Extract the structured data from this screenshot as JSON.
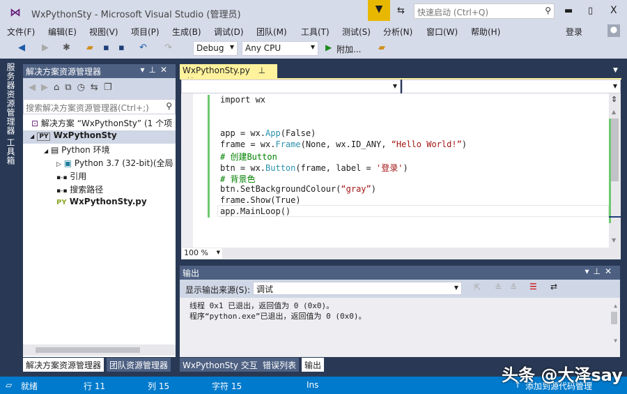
{
  "window": {
    "title": "WxPythonSty - Microsoft Visual Studio (管理员)",
    "quick_launch_placeholder": "快速启动 (Ctrl+Q)",
    "signin": "登录"
  },
  "menu": [
    "文件(F)",
    "编辑(E)",
    "视图(V)",
    "项目(P)",
    "生成(B)",
    "调试(D)",
    "团队(M)",
    "工具(T)",
    "测试(S)",
    "分析(N)",
    "窗口(W)",
    "帮助(H)"
  ],
  "toolbar": {
    "config": "Debug",
    "platform": "Any CPU",
    "attach": "附加..."
  },
  "side_tabs": [
    "服务器资源管理器",
    "工具箱"
  ],
  "solution_explorer": {
    "title": "解决方案资源管理器",
    "search_placeholder": "搜索解决方案资源管理器(Ctrl+;)",
    "tree": [
      {
        "label": "解决方案 “WxPythonSty” (1 个项",
        "icon": "solution-icon",
        "indent": 0
      },
      {
        "label": "WxPythonSty",
        "icon": "python-project-icon",
        "indent": 1,
        "bold": true,
        "selected": true
      },
      {
        "label": "Python 环境",
        "icon": "environment-icon",
        "indent": 2
      },
      {
        "label": "Python 3.7 (32-bit)(全局",
        "icon": "interpreter-icon",
        "indent": 3
      },
      {
        "label": "引用",
        "icon": "references-icon",
        "indent": 2
      },
      {
        "label": "搜索路径",
        "icon": "search-path-icon",
        "indent": 2
      },
      {
        "label": "WxPythonSty.py",
        "icon": "python-file-icon",
        "indent": 2,
        "bold": true
      }
    ],
    "tabs": [
      "解决方案资源管理器",
      "团队资源管理器"
    ]
  },
  "editor": {
    "tab": "WxPythonSty.py",
    "zoom": "100 %",
    "lines": [
      [
        [
          "import wx",
          "#1e1e1e"
        ]
      ],
      [],
      [],
      [
        [
          "app = wx.",
          "#1e1e1e"
        ],
        [
          "App",
          "#2b91af"
        ],
        [
          "(False)",
          "#1e1e1e"
        ]
      ],
      [
        [
          "frame = wx.",
          "#1e1e1e"
        ],
        [
          "Frame",
          "#2b91af"
        ],
        [
          "(None, wx.ID_ANY, ",
          "#1e1e1e"
        ],
        [
          "“Hello World!”",
          "#a31515"
        ],
        [
          ")",
          "#1e1e1e"
        ]
      ],
      [
        [
          "# 创建Button",
          "#008000"
        ]
      ],
      [
        [
          "btn = wx.",
          "#1e1e1e"
        ],
        [
          "Button",
          "#2b91af"
        ],
        [
          "(frame, label = ",
          "#1e1e1e"
        ],
        [
          "'登录'",
          "#a31515"
        ],
        [
          ")",
          "#1e1e1e"
        ]
      ],
      [
        [
          "# 背景色",
          "#008000"
        ]
      ],
      [
        [
          "btn.SetBackgroundColour(",
          "#1e1e1e"
        ],
        [
          "“gray”",
          "#a31515"
        ],
        [
          ")",
          "#1e1e1e"
        ]
      ],
      [
        [
          "frame.Show(True)",
          "#1e1e1e"
        ]
      ],
      [
        [
          "app.MainLoop()",
          "#1e1e1e"
        ]
      ]
    ]
  },
  "output": {
    "title": "输出",
    "source_label": "显示输出来源(S):",
    "source_value": "调试",
    "lines": [
      "线程 0x1 已退出，返回值为 0 (0x0)。",
      "程序“python.exe”已退出，返回值为 0 (0x0)。"
    ],
    "tabs": [
      "WxPythonSty 交互",
      "错误列表",
      "输出"
    ]
  },
  "status": {
    "ready": "就绪",
    "line": "行 11",
    "col": "列 15",
    "char": "字符 15",
    "mode": "Ins",
    "source_control": "添加到源代码管理"
  },
  "watermark": "头条 @大泽say"
}
